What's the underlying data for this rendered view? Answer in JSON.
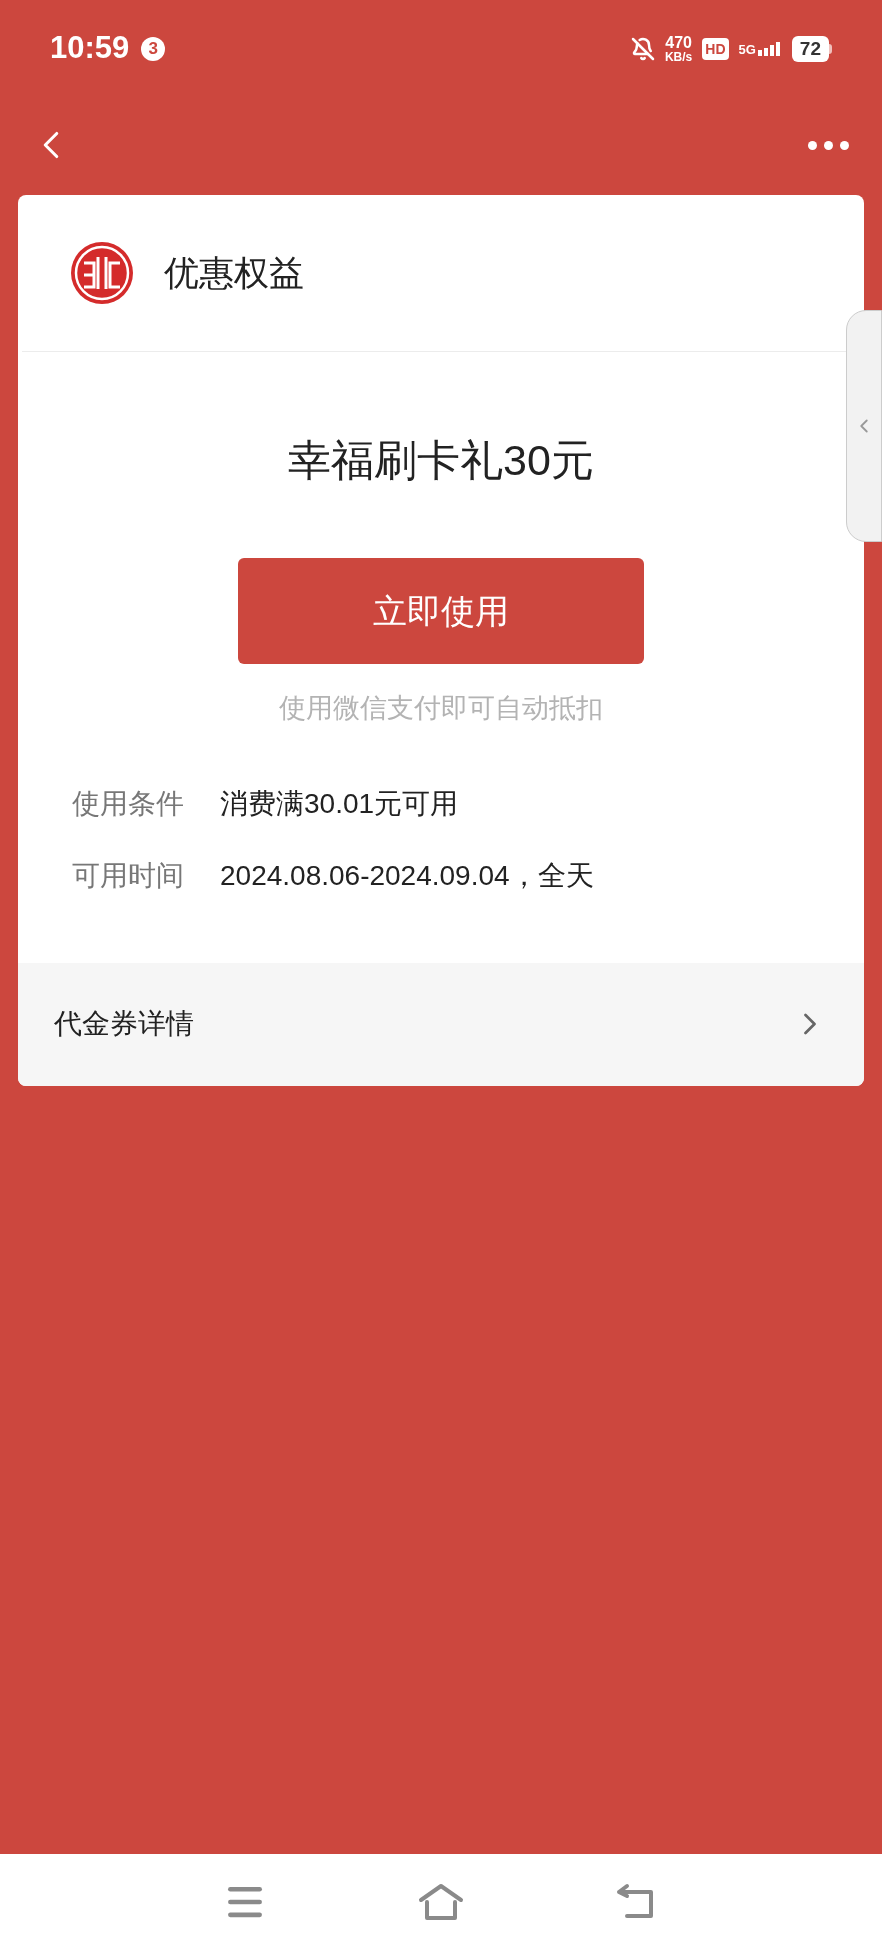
{
  "status_bar": {
    "time": "10:59",
    "notification_count": "3",
    "speed_value": "470",
    "speed_unit": "KB/s",
    "hd": "HD",
    "network": "5G",
    "battery": "72"
  },
  "card": {
    "header_title": "优惠权益",
    "coupon_title": "幸福刷卡礼30元",
    "use_button": "立即使用",
    "hint": "使用微信支付即可自动抵扣",
    "info_rows": [
      {
        "label": "使用条件",
        "value": "消费满30.01元可用"
      },
      {
        "label": "可用时间",
        "value": "2024.08.06-2024.09.04，全天"
      }
    ],
    "details_link": "代金券详情"
  }
}
